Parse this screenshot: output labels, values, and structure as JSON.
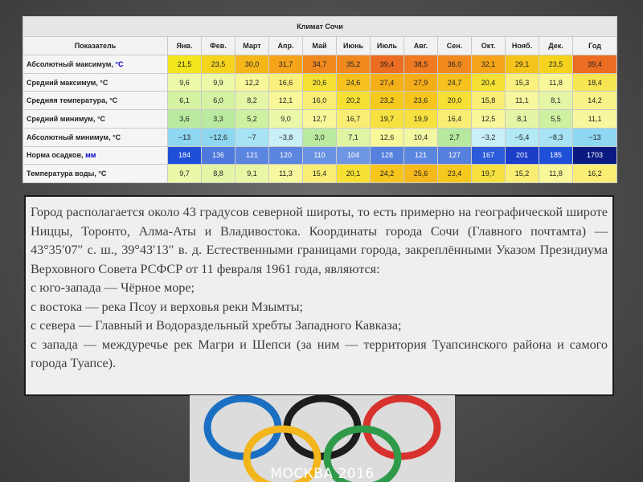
{
  "climate_table": {
    "title": "Климат Сочи",
    "header": [
      "Показатель",
      "Янв.",
      "Фев.",
      "Март",
      "Апр.",
      "Май",
      "Июнь",
      "Июль",
      "Авг.",
      "Сен.",
      "Окт.",
      "Нояб.",
      "Дек.",
      "Год"
    ],
    "rows": [
      {
        "label": "Абсолютный максимум, ",
        "unit": "°C",
        "values": [
          "21,5",
          "23,5",
          "30,0",
          "31,7",
          "34,7",
          "35,2",
          "39,4",
          "38,5",
          "36,0",
          "32,1",
          "29,1",
          "23,5",
          "39,4"
        ],
        "colors": [
          "#f3e61c",
          "#f6d41e",
          "#f5b619",
          "#f5a419",
          "#f08a1f",
          "#f08a1f",
          "#ec6c22",
          "#ef7a20",
          "#f08a1f",
          "#f5a419",
          "#f5c41b",
          "#f6d41e",
          "#ec6c22"
        ]
      },
      {
        "label": "Средний максимум, °C",
        "unit": "",
        "values": [
          "9,6",
          "9,9",
          "12,2",
          "16,6",
          "20,6",
          "24,6",
          "27,4",
          "27,9",
          "24,7",
          "20,4",
          "15,3",
          "11,8",
          "18,4"
        ],
        "colors": [
          "#eef9a8",
          "#eef9a8",
          "#f8f79a",
          "#faf07c",
          "#f5e033",
          "#f6c11e",
          "#f5b019",
          "#f5ad19",
          "#f6c11e",
          "#f5e033",
          "#f9f17f",
          "#f8f79a",
          "#f7e551"
        ]
      },
      {
        "label": "Средняя температура, °C",
        "unit": "",
        "values": [
          "6,1",
          "6,0",
          "8,2",
          "12,1",
          "16,0",
          "20,2",
          "23,2",
          "23,6",
          "20,0",
          "15,8",
          "11,1",
          "8,1",
          "14,2"
        ],
        "colors": [
          "#d5f2a2",
          "#d5f2a2",
          "#e4f6a5",
          "#f8f79a",
          "#f9ee73",
          "#f5e033",
          "#f6c91e",
          "#f6c61e",
          "#f5e033",
          "#f9ee73",
          "#f6f79e",
          "#e4f6a5",
          "#f9f288"
        ]
      },
      {
        "label": "Средний минимум, °C",
        "unit": "",
        "values": [
          "3,6",
          "3,3",
          "5,2",
          "9,0",
          "12,7",
          "16,7",
          "19,7",
          "19,9",
          "16,4",
          "12,5",
          "8,1",
          "5,5",
          "11,1"
        ],
        "colors": [
          "#b9ea9f",
          "#b9ea9f",
          "#cdf0a1",
          "#ebf8a7",
          "#f8f79a",
          "#f9ee73",
          "#f6e140",
          "#f6e140",
          "#f9ee73",
          "#f8f79a",
          "#e4f6a5",
          "#cdf0a1",
          "#f6f79e"
        ]
      },
      {
        "label": "Абсолютный минимум, °C",
        "unit": "",
        "values": [
          "−13",
          "−12,6",
          "−7",
          "−3,8",
          "3,0",
          "7,1",
          "12,6",
          "10,4",
          "2,7",
          "−3,2",
          "−5,4",
          "−8,3",
          "−13"
        ],
        "colors": [
          "#8ed7f0",
          "#8ed7f0",
          "#a6e3f4",
          "#c9eff8",
          "#b9ea9f",
          "#e0f5a4",
          "#f8f79a",
          "#f2f8a2",
          "#b6e99e",
          "#c9eff8",
          "#b3e8f5",
          "#a6e3f4",
          "#8ed7f0"
        ]
      },
      {
        "label": "Норма осадков, ",
        "unit": "мм",
        "values": [
          "184",
          "136",
          "121",
          "120",
          "110",
          "104",
          "128",
          "121",
          "127",
          "167",
          "201",
          "185",
          "1703"
        ],
        "colors": [
          "#1f4fd6",
          "#4d78dc",
          "#5b86df",
          "#5b86df",
          "#6a92e2",
          "#6f96e3",
          "#5580dd",
          "#5b86df",
          "#5580dd",
          "#2c5ad8",
          "#1a3ec8",
          "#1f4fd6",
          "#0a1a82"
        ]
      },
      {
        "label": "Температура воды, °C",
        "unit": "",
        "values": [
          "9,7",
          "8,8",
          "9,1",
          "11,3",
          "15,4",
          "20,1",
          "24,2",
          "25,6",
          "23,4",
          "19,7",
          "15,2",
          "11,8",
          "16,2"
        ],
        "colors": [
          "#ebf8a7",
          "#e4f6a5",
          "#e8f7a6",
          "#f6f79e",
          "#f9ee73",
          "#f5e033",
          "#f6c51e",
          "#f6b91c",
          "#f6c81e",
          "#f6e140",
          "#f9ee73",
          "#f8f79a",
          "#f9ee73"
        ]
      }
    ]
  },
  "text_box": {
    "paragraph": "Город располагается около 43 градусов северной широты, то есть примерно на географической широте Ниццы, Торонто, Алма-Аты и Владивостока. Координаты города Сочи (Главного почтамта) — 43°35′07″ с. ш., 39°43′13″ в. д. Естественными границами города, закреплёнными Указом Президиума Верховного Совета РСФСР от 11 февраля 1961 года, являются:",
    "items": [
      "с юго-запада — Чёрное море;",
      "с востока — река Псоу и верховья реки Мзымты;",
      "с севера — Главный и Водораздельный хребты Западного Кавказа;",
      "с запада — междуречье рек Магри и Шепси (за ним — территория Туапсинского района и самого города Туапсе)."
    ]
  },
  "olympic_image": {
    "caption": "МОСКВА 2016",
    "ring_colors": [
      "#1a6fc2",
      "#1d1d1d",
      "#d8322e",
      "#f2b51b",
      "#2f9b4a"
    ]
  }
}
